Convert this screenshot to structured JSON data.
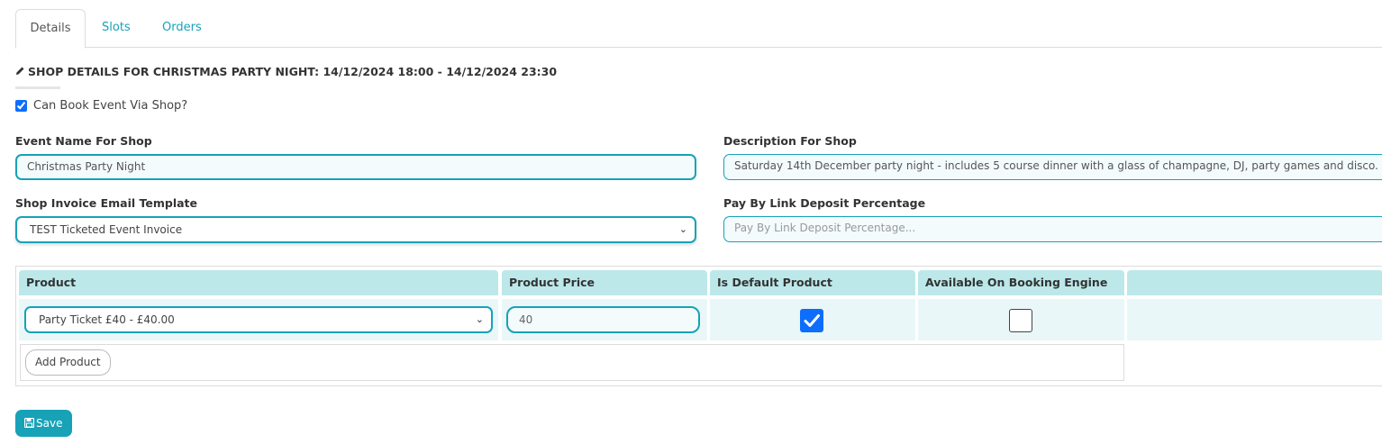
{
  "tabs": [
    {
      "label": "Details",
      "active": true
    },
    {
      "label": "Slots",
      "active": false
    },
    {
      "label": "Orders",
      "active": false
    }
  ],
  "page": {
    "title": "SHOP DETAILS FOR CHRISTMAS PARTY NIGHT: 14/12/2024 18:00 - 14/12/2024 23:30",
    "title_icon": "pencil-icon"
  },
  "can_book": {
    "label": "Can Book Event Via Shop?",
    "checked": true
  },
  "form": {
    "event_name": {
      "label": "Event Name For Shop",
      "value": "Christmas Party Night"
    },
    "description": {
      "label": "Description For Shop",
      "value": "Saturday 14th December party night - includes 5 course dinner with a glass of champagne, DJ, party games and disco."
    },
    "invoice_template": {
      "label": "Shop Invoice Email Template",
      "value": "TEST Ticketed Event Invoice"
    },
    "deposit": {
      "label": "Pay By Link Deposit Percentage",
      "placeholder": "Pay By Link Deposit Percentage..."
    }
  },
  "products_table": {
    "headers": [
      "Product",
      "Product Price",
      "Is Default Product",
      "Available On Booking Engine",
      ""
    ],
    "rows": [
      {
        "product": "Party Ticket £40 - £40.00",
        "price": "40",
        "is_default": true,
        "available_on_booking_engine": false
      }
    ],
    "add_label": "Add Product"
  },
  "save_label": "Save",
  "colors": {
    "accent": "#17a2b8",
    "header_bg": "#bce8ea",
    "checkbox": "#0d6efd"
  }
}
